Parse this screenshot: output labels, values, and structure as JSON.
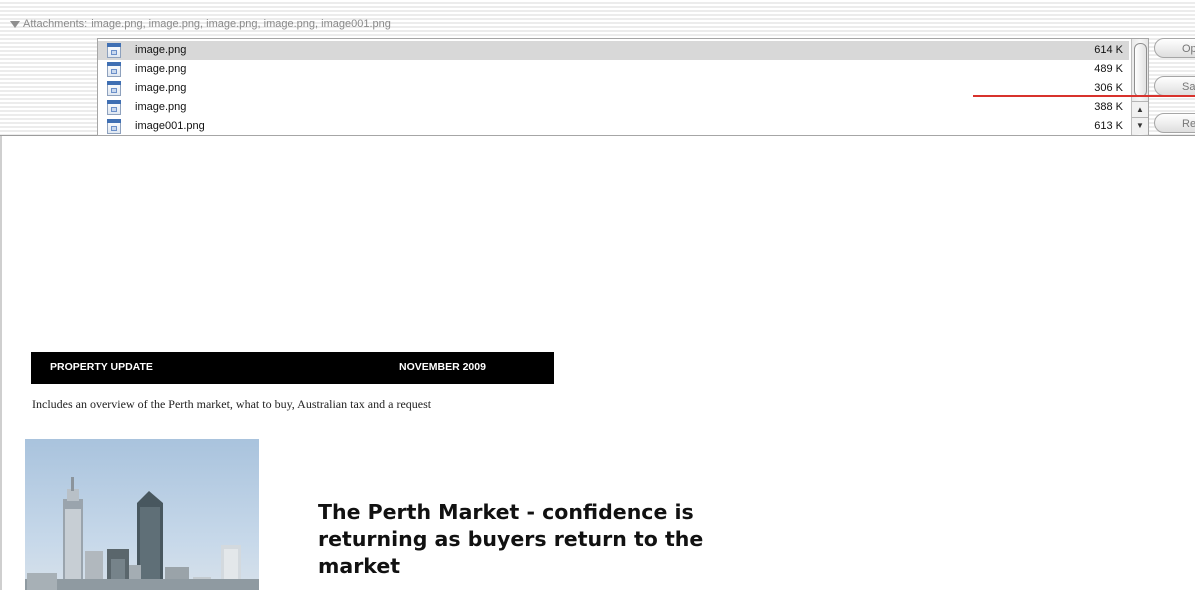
{
  "attachments": {
    "summary_label": "Attachments:",
    "summary_files": "image.png, image.png, image.png, image.png, image001.png",
    "items": [
      {
        "name": "image.png",
        "size": "614 K"
      },
      {
        "name": "image.png",
        "size": "489 K"
      },
      {
        "name": "image.png",
        "size": "306 K"
      },
      {
        "name": "image.png",
        "size": "388 K"
      },
      {
        "name": "image001.png",
        "size": "613 K"
      }
    ],
    "buttons": {
      "open": "Open",
      "save": "Save",
      "remove": "Remove"
    }
  },
  "newsletter": {
    "banner_left": "PROPERTY UPDATE",
    "banner_right": "NOVEMBER 2009",
    "intro": "Includes an overview of the Perth market, what to buy, Australian tax and a request",
    "headline": "The Perth Market - confidence is returning as buyers return to the market"
  },
  "colors": {
    "banner_bg": "#000000",
    "selected_row": "#d8d8d8",
    "annotation_line": "#d8322c"
  }
}
